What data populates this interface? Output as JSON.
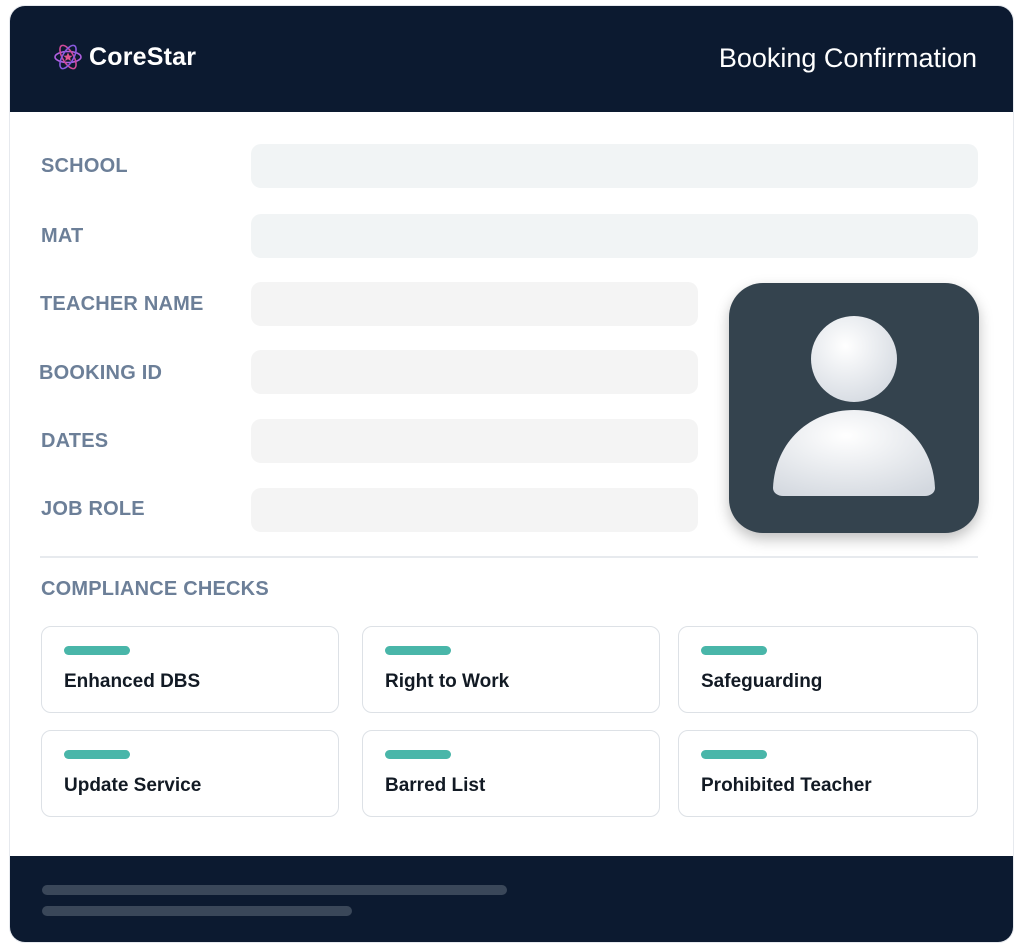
{
  "header": {
    "brand": "CoreStar",
    "title": "Booking Confirmation"
  },
  "form": {
    "school_label": "SCHOOL",
    "mat_label": "MAT",
    "teacher_name_label": "TEACHER NAME",
    "booking_id_label": "BOOKING ID",
    "dates_label": "DATES",
    "job_role_label": "JOB ROLE"
  },
  "compliance": {
    "heading": "COMPLIANCE CHECKS",
    "checks": [
      {
        "label": "Enhanced DBS"
      },
      {
        "label": "Right to Work"
      },
      {
        "label": "Safeguarding"
      },
      {
        "label": "Update Service"
      },
      {
        "label": "Barred List"
      },
      {
        "label": "Prohibited Teacher"
      }
    ],
    "status_color": "#49b6a9"
  },
  "colors": {
    "header_bg": "#0c1a30",
    "label": "#6c7f98",
    "logo_accent": "#c04fd0"
  },
  "icons": {
    "logo": "atom-star-icon",
    "avatar": "person-silhouette-icon"
  }
}
